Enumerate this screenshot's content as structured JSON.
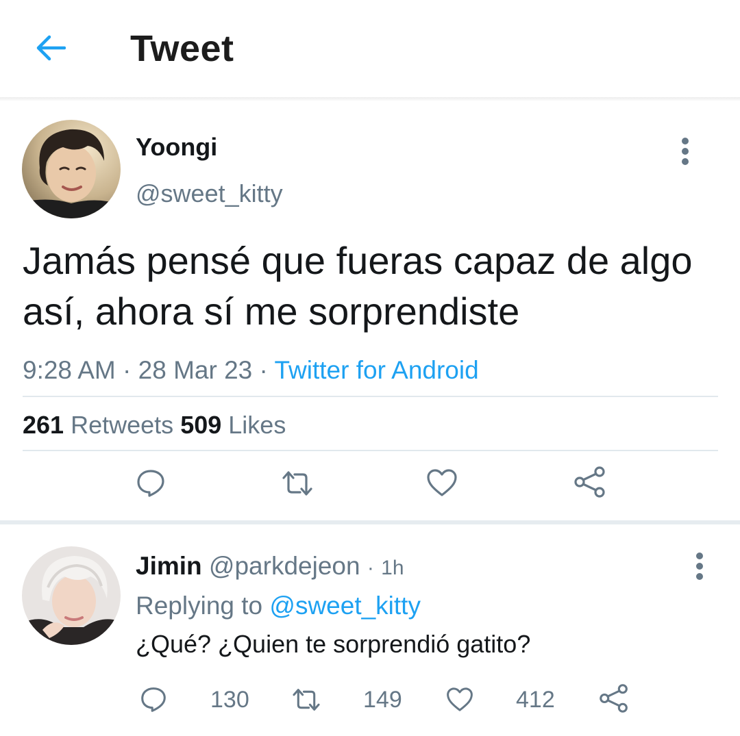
{
  "header": {
    "title": "Tweet",
    "back_icon": "arrow-left-icon"
  },
  "tweet": {
    "author_name": "Yoongi",
    "author_handle": "@sweet_kitty",
    "text": "Jamás pensé que fueras capaz de algo así, ahora sí me sorprendiste",
    "time": "9:28 AM",
    "date": "28 Mar 23",
    "separator": "·",
    "source": "Twitter for Android",
    "retweets_count": "261",
    "retweets_label": "Retweets",
    "likes_count": "509",
    "likes_label": "Likes",
    "actions": [
      "reply-icon",
      "retweet-icon",
      "like-icon",
      "share-icon"
    ]
  },
  "reply": {
    "author_name": "Jimin",
    "author_handle": "@parkdejeon",
    "separator": "·",
    "time": "1h",
    "replying_label": "Replying to",
    "replying_to": "@sweet_kitty",
    "text": "¿Qué? ¿Quien te sorprendió gatito?",
    "reply_count": "130",
    "retweet_count": "149",
    "like_count": "412"
  },
  "colors": {
    "accent": "#1da1f2",
    "secondary_text": "#657786",
    "icon": "#657786",
    "divider": "#e1e8ed"
  }
}
